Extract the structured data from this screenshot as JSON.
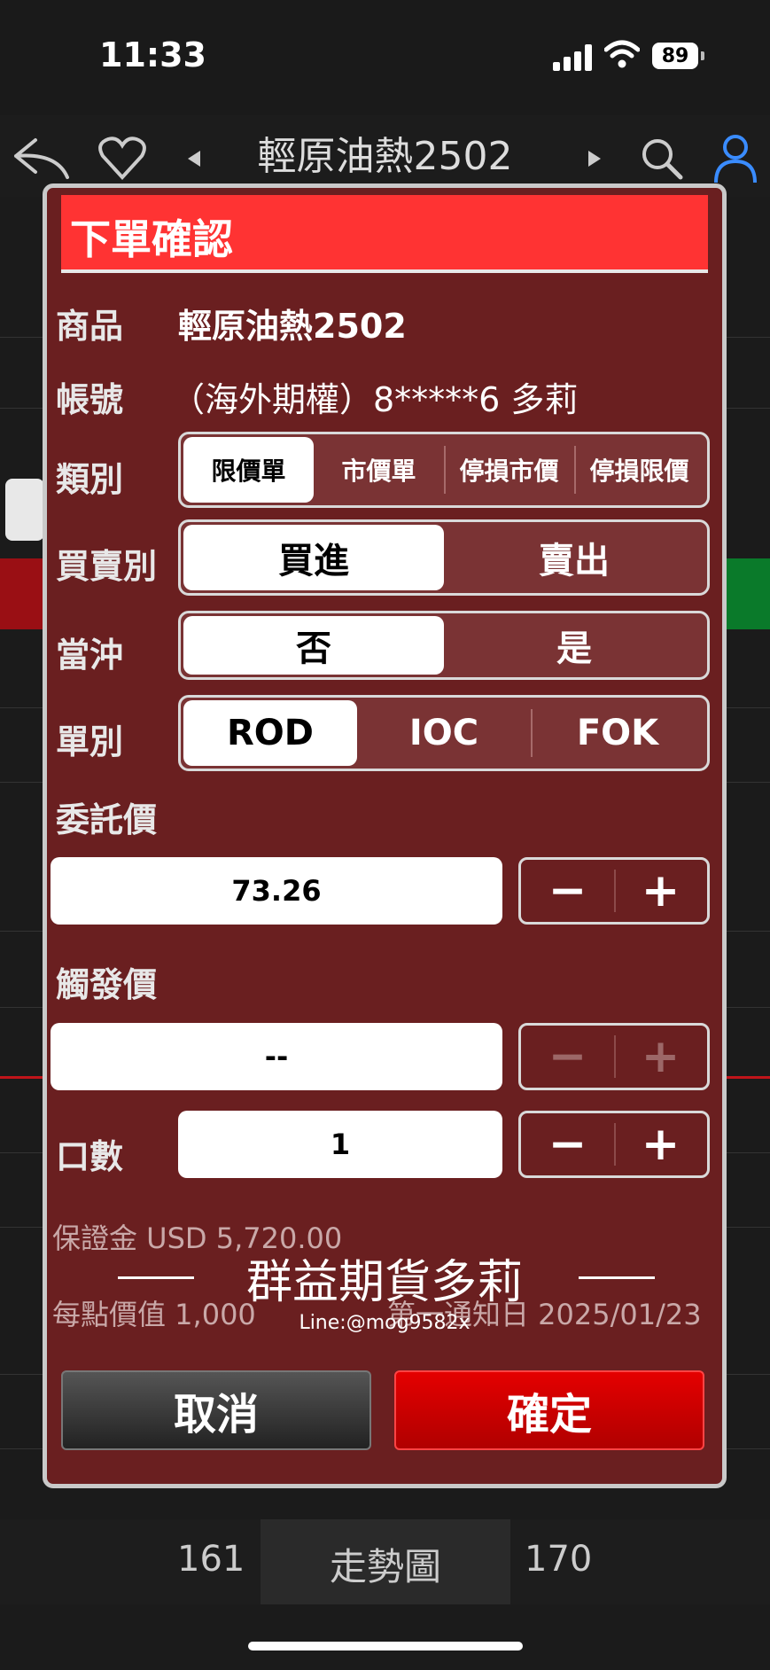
{
  "status_bar": {
    "time": "11:33",
    "battery": "89"
  },
  "background": {
    "title": "輕原油熱2502",
    "bottom_left": "161",
    "bottom_mid": "走勢圖",
    "bottom_right": "170"
  },
  "dialog": {
    "title": "下單確認",
    "product": {
      "label": "商品",
      "value": "輕原油熱2502"
    },
    "account": {
      "label": "帳號",
      "value": "（海外期權）8*****6   多莉"
    },
    "order_type": {
      "label": "類別",
      "options": [
        "限價單",
        "市價單",
        "停損市價",
        "停損限價"
      ],
      "selected": "限價單"
    },
    "side": {
      "label": "買賣別",
      "options": [
        "買進",
        "賣出"
      ],
      "selected": "買進"
    },
    "day_trade": {
      "label": "當沖",
      "options": [
        "否",
        "是"
      ],
      "selected": "否"
    },
    "time_in_force": {
      "label": "單別",
      "options": [
        "ROD",
        "IOC",
        "FOK"
      ],
      "selected": "ROD"
    },
    "price": {
      "label": "委託價",
      "value": "73.26"
    },
    "trigger_price": {
      "label": "觸發價",
      "value": "--"
    },
    "quantity": {
      "label": "口數",
      "value": "1"
    },
    "stepper": {
      "minus": "−",
      "plus": "+"
    },
    "margin": "保證金  USD  5,720.00",
    "point_value": "每點價值  1,000",
    "first_notice": "第一通知日  2025/01/23",
    "watermark": "群益期貨多莉",
    "watermark_sub": "Line:@mog9582x",
    "cancel_label": "取消",
    "confirm_label": "確定"
  }
}
